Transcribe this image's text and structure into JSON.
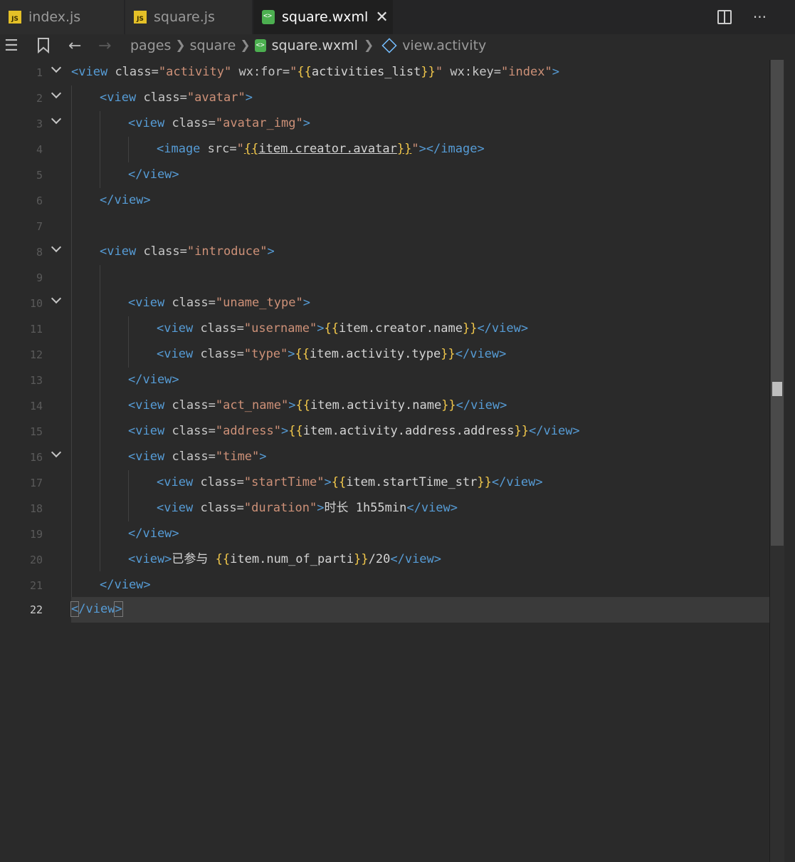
{
  "tabs": [
    {
      "label": "index.js",
      "icon": "js-file-icon",
      "active": false
    },
    {
      "label": "square.js",
      "icon": "js-file-icon",
      "active": false
    },
    {
      "label": "square.wxml",
      "icon": "wxml-file-icon",
      "active": true
    }
  ],
  "tab_actions": {
    "more": "···"
  },
  "breadcrumb": {
    "items": [
      "pages",
      "square"
    ],
    "file": "square.wxml",
    "symbol": "view.activity"
  },
  "editor": {
    "current_line": 22,
    "lines": [
      {
        "n": "1"
      },
      {
        "n": "2"
      },
      {
        "n": "3"
      },
      {
        "n": "4"
      },
      {
        "n": "5"
      },
      {
        "n": "6"
      },
      {
        "n": "7"
      },
      {
        "n": "8"
      },
      {
        "n": "9"
      },
      {
        "n": "10"
      },
      {
        "n": "11"
      },
      {
        "n": "12"
      },
      {
        "n": "13"
      },
      {
        "n": "14"
      },
      {
        "n": "15"
      },
      {
        "n": "16"
      },
      {
        "n": "17"
      },
      {
        "n": "18"
      },
      {
        "n": "19"
      },
      {
        "n": "20"
      },
      {
        "n": "21"
      },
      {
        "n": "22"
      }
    ]
  },
  "colors": {
    "tag": "#569cd6",
    "string": "#ce9178",
    "brace": "#f2c84b",
    "text": "#d4d4d4",
    "background": "#2a2a2a"
  }
}
